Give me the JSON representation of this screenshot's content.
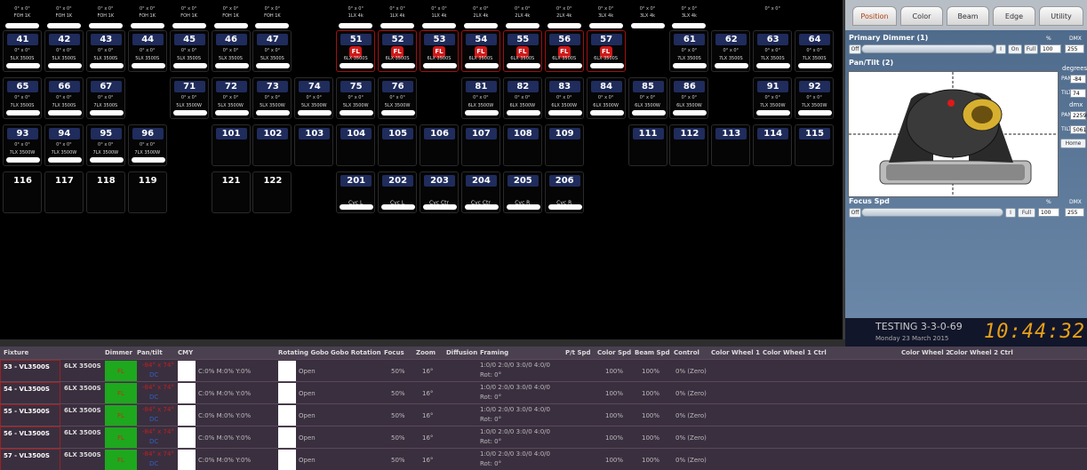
{
  "grid": {
    "top_row": [
      {
        "angle": "0° x 0°",
        "fixture": "FOH 1K"
      },
      {
        "angle": "0° x 0°",
        "fixture": "FOH 1K"
      },
      {
        "angle": "0° x 0°",
        "fixture": "FOH 1K"
      },
      {
        "angle": "0° x 0°",
        "fixture": "FOH 1K"
      },
      {
        "angle": "0° x 0°",
        "fixture": "FOH 1K"
      },
      {
        "angle": "0° x 0°",
        "fixture": "FOH 1K"
      },
      {
        "angle": "0° x 0°",
        "fixture": "FOH 1K"
      },
      {
        "angle": "0° x 0°",
        "fixture": "1LX 4k"
      },
      {
        "angle": "0° x 0°",
        "fixture": "1LX 4k"
      },
      {
        "angle": "0° x 0°",
        "fixture": "1LX 4k"
      },
      {
        "angle": "0° x 0°",
        "fixture": "2LX 4k"
      },
      {
        "angle": "0° x 0°",
        "fixture": "2LX 4k"
      },
      {
        "angle": "0° x 0°",
        "fixture": "2LX 4k"
      },
      {
        "angle": "0° x 0°",
        "fixture": "3LX 4k"
      },
      {
        "angle": "0° x 0°",
        "fixture": "3LX 4k"
      },
      {
        "angle": "0° x 0°",
        "fixture": "3LX 4k"
      },
      {
        "angle": "0° x 0°",
        "fixture": ""
      }
    ],
    "row1": [
      {
        "num": "41",
        "angle": "0° x 0°",
        "fixture": "5LX 3500S"
      },
      {
        "num": "42",
        "angle": "0° x 0°",
        "fixture": "5LX 3500S"
      },
      {
        "num": "43",
        "angle": "0° x 0°",
        "fixture": "5LX 3500S"
      },
      {
        "num": "44",
        "angle": "0° x 0°",
        "fixture": "5LX 3500S"
      },
      {
        "num": "45",
        "angle": "0° x 0°",
        "fixture": "5LX 3500S"
      },
      {
        "num": "46",
        "angle": "0° x 0°",
        "fixture": "5LX 3500S"
      },
      {
        "num": "47",
        "angle": "0° x 0°",
        "fixture": "5LX 3500S"
      },
      {
        "num": "51",
        "fl": "FL",
        "dc": "DC",
        "fixture": "6LX 3500S"
      },
      {
        "num": "52",
        "fl": "FL",
        "dc": "DC",
        "fixture": "6LX 3500S"
      },
      {
        "num": "53",
        "fl": "FL",
        "dc": "DC",
        "fixture": "6LX 3500S"
      },
      {
        "num": "54",
        "fl": "FL",
        "dc": "DC",
        "fixture": "6LX 3500S"
      },
      {
        "num": "55",
        "fl": "FL",
        "dc": "DC",
        "fixture": "6LX 3500S"
      },
      {
        "num": "56",
        "fl": "FL",
        "dc": "DC",
        "fixture": "6LX 3500S"
      },
      {
        "num": "57",
        "fl": "FL",
        "dc": "DC",
        "fixture": "6LX 3500S"
      },
      {
        "num": "61",
        "angle": "0° x 0°",
        "fixture": "7LX 3500S"
      },
      {
        "num": "62",
        "angle": "0° x 0°",
        "fixture": "7LX 3500S"
      },
      {
        "num": "63",
        "angle": "0° x 0°",
        "fixture": "7LX 3500S"
      },
      {
        "num": "64",
        "angle": "0° x 0°",
        "fixture": "7LX 3500S"
      }
    ],
    "row2": [
      {
        "num": "65",
        "angle": "0° x 0°",
        "fixture": "7LX 3500S"
      },
      {
        "num": "66",
        "angle": "0° x 0°",
        "fixture": "7LX 3500S"
      },
      {
        "num": "67",
        "angle": "0° x 0°",
        "fixture": "7LX 3500S"
      },
      {
        "num": "71",
        "angle": "0° x 0°",
        "fixture": "5LX 3500W"
      },
      {
        "num": "72",
        "angle": "0° x 0°",
        "fixture": "5LX 3500W"
      },
      {
        "num": "73",
        "angle": "0° x 0°",
        "fixture": "5LX 3500W"
      },
      {
        "num": "74",
        "angle": "0° x 0°",
        "fixture": "5LX 3500W"
      },
      {
        "num": "75",
        "angle": "0° x 0°",
        "fixture": "5LX 3500W"
      },
      {
        "num": "76",
        "angle": "0° x 0°",
        "fixture": "5LX 3500W"
      },
      {
        "num": "81",
        "angle": "0° x 0°",
        "fixture": "6LX 3500W"
      },
      {
        "num": "82",
        "angle": "0° x 0°",
        "fixture": "6LX 3500W"
      },
      {
        "num": "83",
        "angle": "0° x 0°",
        "fixture": "6LX 3500W"
      },
      {
        "num": "84",
        "angle": "0° x 0°",
        "fixture": "6LX 3500W"
      },
      {
        "num": "85",
        "angle": "0° x 0°",
        "fixture": "6LX 3500W"
      },
      {
        "num": "86",
        "angle": "0° x 0°",
        "fixture": "6LX 3500W"
      },
      {
        "num": "91",
        "angle": "0° x 0°",
        "fixture": "7LX 3500W"
      },
      {
        "num": "92",
        "angle": "0° x 0°",
        "fixture": "7LX 3500W"
      }
    ],
    "row3": [
      {
        "num": "93",
        "angle": "0° x 0°",
        "fixture": "7LX 3500W"
      },
      {
        "num": "94",
        "angle": "0° x 0°",
        "fixture": "7LX 3500W"
      },
      {
        "num": "95",
        "angle": "0° x 0°",
        "fixture": "7LX 3500W"
      },
      {
        "num": "96",
        "angle": "0° x 0°",
        "fixture": "7LX 3500W"
      },
      {
        "num": "101"
      },
      {
        "num": "102"
      },
      {
        "num": "103"
      },
      {
        "num": "104"
      },
      {
        "num": "105"
      },
      {
        "num": "106"
      },
      {
        "num": "107"
      },
      {
        "num": "108"
      },
      {
        "num": "109"
      },
      {
        "num": "111"
      },
      {
        "num": "112"
      },
      {
        "num": "113"
      },
      {
        "num": "114"
      },
      {
        "num": "115"
      }
    ],
    "row4": [
      {
        "num": "116"
      },
      {
        "num": "117"
      },
      {
        "num": "118"
      },
      {
        "num": "119"
      },
      {
        "num": "121"
      },
      {
        "num": "122"
      },
      {
        "num": "201",
        "cyc": "Cyc L"
      },
      {
        "num": "202",
        "cyc": "Cyc L"
      },
      {
        "num": "203",
        "cyc": "Cyc Ctr"
      },
      {
        "num": "204",
        "cyc": "Cyc Ctr"
      },
      {
        "num": "205",
        "cyc": "Cyc R"
      },
      {
        "num": "206",
        "cyc": "Cyc R"
      }
    ]
  },
  "panel": {
    "tabs": [
      "Position",
      "Color",
      "Beam",
      "Edge",
      "Utility"
    ],
    "primary_dimmer": {
      "label": "Primary Dimmer (1)",
      "off": "Off",
      "on": "On",
      "full": "Full",
      "pct_value": "100",
      "dmx_value": "255",
      "pct_label": "%",
      "dmx_label": "DMX"
    },
    "pantilt": {
      "label": "Pan/Tilt (2)",
      "degrees": "degrees",
      "pan_label": "PAN",
      "tilt_label": "TILT",
      "pan_deg": "-84",
      "tilt_deg": "74",
      "dmx_label": "dmx",
      "pan_dmx": "22598",
      "tilt_dmx": "50611",
      "home": "Home"
    },
    "focus": {
      "label": "Focus Spd",
      "off": "Off",
      "full": "Full",
      "pct_value": "100",
      "dmx_value": "255",
      "pct_label": "%",
      "dmx_label": "DMX"
    },
    "testing": "TESTING 3-3-0-69",
    "date": "Monday 23 March  2015",
    "clock": "10:44:32"
  },
  "table": {
    "headers": [
      "Fixture",
      "Dimmer",
      "Pan/tilt",
      "CMY",
      "Rotating Gobo",
      "Gobo Rotation",
      "Focus",
      "Zoom",
      "Diffusion",
      "Framing",
      "P/t Spd",
      "Color Spd",
      "Beam Spd",
      "Control",
      "Color Wheel 1",
      "Color Wheel 1 Ctrl",
      "Color Wheel 2",
      "Color Wheel 2 Ctrl"
    ],
    "rows": [
      {
        "fixture": "53 - VL3500S",
        "type": "6LX 3500S",
        "dimmer": "FL",
        "pantilt": "-84° x 74°",
        "pt_dc": "DC",
        "cmy": "C:0% M:0% Y:0%",
        "gobo": "Open",
        "focus": "50%",
        "zoom": "16°",
        "framing": "1:0/0 2:0/0 3:0/0 4:0/0",
        "rot": "Rot: 0°",
        "pt_spd": "100%",
        "color_spd": "100%",
        "control": "0% (Zero)"
      },
      {
        "fixture": "54 - VL3500S",
        "type": "6LX 3500S",
        "dimmer": "FL",
        "pantilt": "-84° x 74°",
        "pt_dc": "DC",
        "cmy": "C:0% M:0% Y:0%",
        "gobo": "Open",
        "focus": "50%",
        "zoom": "16°",
        "framing": "1:0/0 2:0/0 3:0/0 4:0/0",
        "rot": "Rot: 0°",
        "pt_spd": "100%",
        "color_spd": "100%",
        "control": "0% (Zero)"
      },
      {
        "fixture": "55 - VL3500S",
        "type": "6LX 3500S",
        "dimmer": "FL",
        "pantilt": "-84° x 74°",
        "pt_dc": "DC",
        "cmy": "C:0% M:0% Y:0%",
        "gobo": "Open",
        "focus": "50%",
        "zoom": "16°",
        "framing": "1:0/0 2:0/0 3:0/0 4:0/0",
        "rot": "Rot: 0°",
        "pt_spd": "100%",
        "color_spd": "100%",
        "control": "0% (Zero)"
      },
      {
        "fixture": "56 - VL3500S",
        "type": "6LX 3500S",
        "dimmer": "FL",
        "pantilt": "-84° x 74°",
        "pt_dc": "DC",
        "cmy": "C:0% M:0% Y:0%",
        "gobo": "Open",
        "focus": "50%",
        "zoom": "16°",
        "framing": "1:0/0 2:0/0 3:0/0 4:0/0",
        "rot": "Rot: 0°",
        "pt_spd": "100%",
        "color_spd": "100%",
        "control": "0% (Zero)"
      },
      {
        "fixture": "57 - VL3500S",
        "type": "6LX 3500S",
        "dimmer": "FL",
        "pantilt": "-84° x 74°",
        "pt_dc": "DC",
        "cmy": "C:0% M:0% Y:0%",
        "gobo": "Open",
        "focus": "50%",
        "zoom": "16°",
        "framing": "1:0/0 2:0/0 3:0/0 4:0/0",
        "rot": "Rot: 0°",
        "pt_spd": "100%",
        "color_spd": "100%",
        "control": "0% (Zero)"
      }
    ]
  }
}
